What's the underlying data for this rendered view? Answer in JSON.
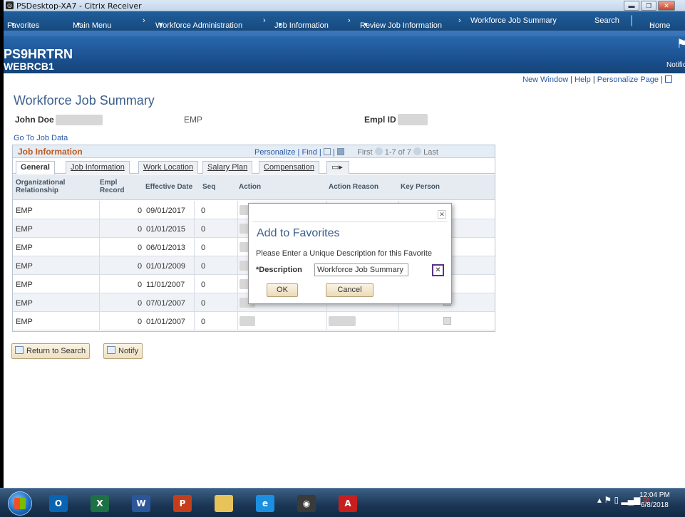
{
  "window": {
    "title": "PSDesktop-XA7 - Citrix Receiver"
  },
  "nav": {
    "favorites": "Favorites",
    "main_menu": "Main Menu",
    "crumbs": [
      "Workforce Administration",
      "Job Information",
      "Review Job Information",
      "Workforce Job Summary"
    ],
    "search": "Search",
    "home": "Home"
  },
  "brand": {
    "system": "PS9HRTRN",
    "instance": "WEBRCB1",
    "notifications": "Notific"
  },
  "toplinks": {
    "new_window": "New Window",
    "help": "Help",
    "personalize_page": "Personalize Page"
  },
  "page": {
    "title": "Workforce Job Summary",
    "employee_name": "John Doe",
    "empl_class": "EMP",
    "empl_id_label": "Empl ID",
    "go_to_job_data": "Go To Job Data"
  },
  "grid": {
    "title": "Job Information",
    "personalize": "Personalize",
    "find": "Find",
    "first": "First",
    "range": "1-7 of 7",
    "last": "Last",
    "tabs": [
      "General",
      "Job Information",
      "Work Location",
      "Salary Plan",
      "Compensation"
    ],
    "columns": [
      "Organizational Relationship",
      "Empl Record",
      "Effective Date",
      "Seq",
      "Action",
      "Action Reason",
      "Key Person"
    ],
    "rows": [
      {
        "org": "EMP",
        "rec": "0",
        "date": "09/01/2017",
        "seq": "0"
      },
      {
        "org": "EMP",
        "rec": "0",
        "date": "01/01/2015",
        "seq": "0"
      },
      {
        "org": "EMP",
        "rec": "0",
        "date": "06/01/2013",
        "seq": "0"
      },
      {
        "org": "EMP",
        "rec": "0",
        "date": "01/01/2009",
        "seq": "0"
      },
      {
        "org": "EMP",
        "rec": "0",
        "date": "11/01/2007",
        "seq": "0"
      },
      {
        "org": "EMP",
        "rec": "0",
        "date": "07/01/2007",
        "seq": "0"
      },
      {
        "org": "EMP",
        "rec": "0",
        "date": "01/01/2007",
        "seq": "0"
      }
    ]
  },
  "buttons": {
    "return_to_search": "Return to Search",
    "notify": "Notify"
  },
  "modal": {
    "title": "Add to Favorites",
    "prompt": "Please Enter a Unique Description for this Favorite",
    "desc_label": "*Description",
    "desc_value": "Workforce Job Summary",
    "ok": "OK",
    "cancel": "Cancel"
  },
  "taskbar": {
    "apps": [
      {
        "icon": "outlook-icon",
        "glyph": "O",
        "color": "#0a64b4"
      },
      {
        "icon": "excel-icon",
        "glyph": "X",
        "color": "#1e7145"
      },
      {
        "icon": "word-icon",
        "glyph": "W",
        "color": "#2b579a"
      },
      {
        "icon": "powerpoint-icon",
        "glyph": "P",
        "color": "#c43e1c"
      },
      {
        "icon": "file-explorer-icon",
        "glyph": "",
        "color": "#e8c35a"
      },
      {
        "icon": "internet-explorer-icon",
        "glyph": "e",
        "color": "#1d8fe0"
      },
      {
        "icon": "citrix-receiver-icon",
        "glyph": "◉",
        "color": "#3a3a3a"
      },
      {
        "icon": "acrobat-icon",
        "glyph": "A",
        "color": "#c81e1e"
      }
    ],
    "time": "12:04 PM",
    "date": "6/8/2018"
  },
  "colors": {
    "nav": "#1f5e9c",
    "title": "#3a5f8c",
    "link": "#2958a5",
    "grid_title": "#c05a1e"
  }
}
